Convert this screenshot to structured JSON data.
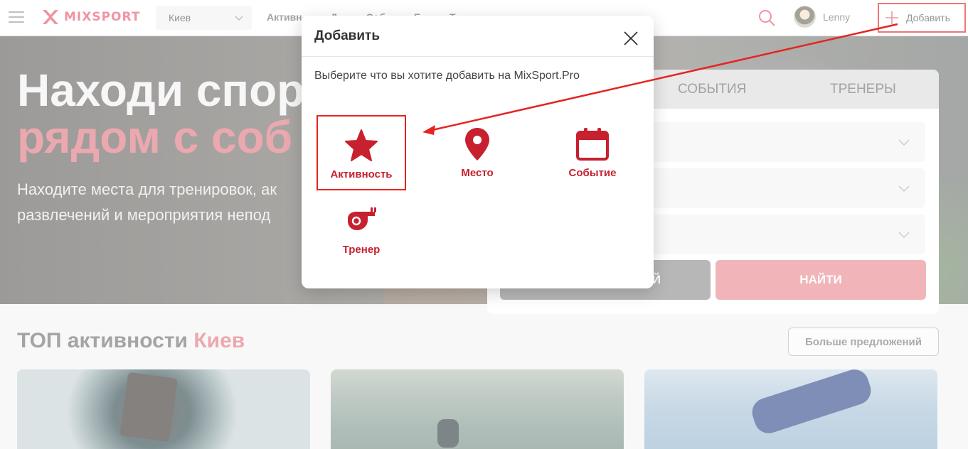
{
  "header": {
    "brand": "MIXSPORT",
    "city": "Киев",
    "nav": [
      "Активн",
      "Д",
      "Соб",
      "Б",
      "Т"
    ],
    "user_name": "Lenny",
    "add_label": "Добавить"
  },
  "hero": {
    "title_line1": "Находи спор",
    "title_line2": "рядом с соб",
    "subtitle": "Находите места для тренировок, ак развлечений и мероприятия непод"
  },
  "search_panel": {
    "tabs": [
      "СОБЫТИЯ",
      "ТРЕНЕРЫ"
    ],
    "secondary_button": "Й",
    "find_button": "НАЙТИ"
  },
  "top_section": {
    "title": "ТОП активности",
    "city": "Киев",
    "more_button": "Больше предложений"
  },
  "modal": {
    "title": "Добавить",
    "description": "Выберите что вы хотите добавить на MixSport.Pro",
    "options": [
      {
        "label": "Активность",
        "icon": "star-icon"
      },
      {
        "label": "Место",
        "icon": "map-pin-icon"
      },
      {
        "label": "Событие",
        "icon": "calendar-icon"
      },
      {
        "label": "Тренер",
        "icon": "whistle-icon"
      }
    ]
  },
  "colors": {
    "brand": "#e8536a",
    "option_red": "#c7202f",
    "highlight": "#e52420"
  }
}
